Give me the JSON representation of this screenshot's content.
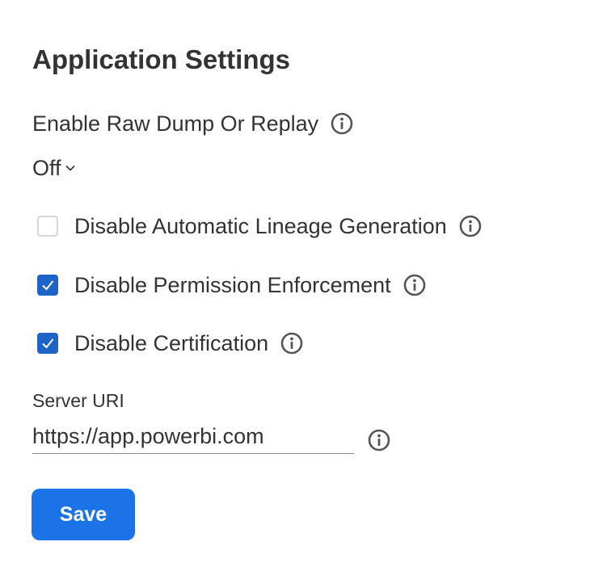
{
  "page": {
    "title": "Application Settings"
  },
  "raw_dump": {
    "label": "Enable Raw Dump Or Replay",
    "info_icon": "info-icon",
    "selected_value": "Off",
    "dropdown_icon": "chevron-down-icon"
  },
  "checkboxes": [
    {
      "label": "Disable Automatic Lineage Generation",
      "checked": false
    },
    {
      "label": "Disable Permission Enforcement",
      "checked": true
    },
    {
      "label": "Disable Certification",
      "checked": true
    }
  ],
  "server_uri": {
    "label": "Server URI",
    "value": "https://app.powerbi.com"
  },
  "actions": {
    "save_label": "Save"
  },
  "colors": {
    "primary_button": "#1c73e8",
    "checkbox_checked": "#1e63c7",
    "text": "#333333"
  }
}
